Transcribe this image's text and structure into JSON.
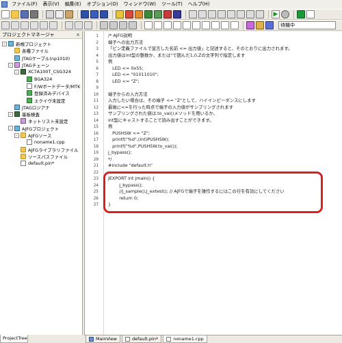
{
  "menu": {
    "items": [
      "ファイル(F)",
      "表示(V)",
      "編集(E)",
      "オプション(O)",
      "ウィンドウ(W)",
      "ツール(T)",
      "ヘルプ(H)"
    ]
  },
  "toolbar": {
    "status_text": "待機中"
  },
  "left_panel": {
    "title": "プロジェクトマネージャ",
    "items": [
      {
        "label": "新規プロジェクト",
        "depth": 0,
        "expander": "-",
        "icon": "project-icon"
      },
      {
        "label": "各種ファイル",
        "depth": 1,
        "expander": "",
        "icon": "folder-icon"
      },
      {
        "label": "JTAGケーブル(np1010)",
        "depth": 1,
        "expander": "",
        "icon": "cable-icon"
      },
      {
        "label": "JTAGチェーン",
        "depth": 1,
        "expander": "-",
        "icon": "chain-icon"
      },
      {
        "label": "XC7A100T_CSG324",
        "depth": 2,
        "expander": "-",
        "icon": "chip-icon"
      },
      {
        "label": "BGA324",
        "depth": 3,
        "expander": "",
        "icon": "package-icon"
      },
      {
        "label": "F/Wボードデータ/MTK",
        "depth": 3,
        "expander": "",
        "icon": "board-icon"
      },
      {
        "label": "登録済みデバイス",
        "depth": 3,
        "expander": "",
        "icon": "device-icon"
      },
      {
        "label": "エクイヴ未設定",
        "depth": 3,
        "expander": "",
        "icon": "device-icon"
      },
      {
        "label": "JTAGロジアナ",
        "depth": 1,
        "expander": "",
        "icon": "analyzer-icon"
      },
      {
        "label": "基板検査",
        "depth": 1,
        "expander": "-",
        "icon": "inspect-icon"
      },
      {
        "label": "ネットリスト未設定",
        "depth": 2,
        "expander": "",
        "icon": "netlist-icon"
      },
      {
        "label": "AJFGプロジェクト",
        "depth": 1,
        "expander": "-",
        "icon": "ajfg-icon"
      },
      {
        "label": "AJFGソース",
        "depth": 2,
        "expander": "-",
        "icon": "folder-icon"
      },
      {
        "label": "noname1.cpp",
        "depth": 3,
        "expander": "",
        "icon": "file-icon"
      },
      {
        "label": "AJFGライブラリファイル",
        "depth": 2,
        "expander": "",
        "icon": "folder-icon"
      },
      {
        "label": "ソースパスファイル",
        "depth": 2,
        "expander": "",
        "icon": "folder-icon"
      },
      {
        "label": "default.pin*",
        "depth": 2,
        "expander": "",
        "icon": "file-icon"
      }
    ],
    "bottom_tab": "ProjectTree"
  },
  "editor": {
    "lines": [
      {
        "n": "1",
        "text": "/* AJFG説明"
      },
      {
        "n": "2",
        "text": "端子への出力方法"
      },
      {
        "n": "3",
        "text": "「ピン定義ファイルで宣言した名前 <= 出力値」と記述すると、そのとおりに出力されます。"
      },
      {
        "n": "4",
        "text": "出力値はint型の整数か、または\"で囲んだ1,0,Zの文字列で指定します"
      },
      {
        "n": "5",
        "text": "例"
      },
      {
        "n": "6",
        "text": "   LED <= 0x55;"
      },
      {
        "n": "7",
        "text": "   LED <= \"01011010\";"
      },
      {
        "n": "8",
        "text": "   LED <= \"Z\";"
      },
      {
        "n": "9",
        "text": ""
      },
      {
        "n": "10",
        "text": "端子からの入力方法"
      },
      {
        "n": "11",
        "text": "入力したい場合は、その端子 <= \"Z\"として、ハイインピーダンスにします"
      },
      {
        "n": "12",
        "text": "最後に<=を行った時点で端子の入力値がサンプリングされます"
      },
      {
        "n": "13",
        "text": "サンプリングされた値は.to_val()メソッドを用いるか、"
      },
      {
        "n": "14",
        "text": "int型にキャストすることで読み出すことができます。"
      },
      {
        "n": "15",
        "text": "例"
      },
      {
        "n": "16",
        "text": "   PUSHSW <= \"Z\";"
      },
      {
        "n": "17",
        "text": "   printf(\"%d\",(int)PUSHSW);"
      },
      {
        "n": "18",
        "text": "   printf(\"%d\",PUSHSW.to_val());"
      },
      {
        "n": "19",
        "text": "j_bypass();"
      },
      {
        "n": "20",
        "text": "*/"
      },
      {
        "n": "21",
        "text": "#include \"default.h\""
      },
      {
        "n": "22",
        "text": ""
      },
      {
        "n": "23",
        "text": "JEXPORT int jmain() {"
      },
      {
        "n": "24",
        "text": "        j_bypass();"
      },
      {
        "n": "25",
        "text": "        //j_sample();j_extest(); // AJFGで端子を操作するにはこの行を有効にしてください"
      },
      {
        "n": "26",
        "text": "        return 0;"
      },
      {
        "n": "27",
        "text": "}"
      }
    ]
  },
  "bottom_tabs": [
    {
      "label": "MainView",
      "active": false
    },
    {
      "label": "default.pin*",
      "active": false
    },
    {
      "label": "noname1.cpp",
      "active": true
    }
  ],
  "colors": {
    "highlight": "#d82020",
    "tree_folder": "#f2c94c",
    "background": "#ece9e2"
  }
}
